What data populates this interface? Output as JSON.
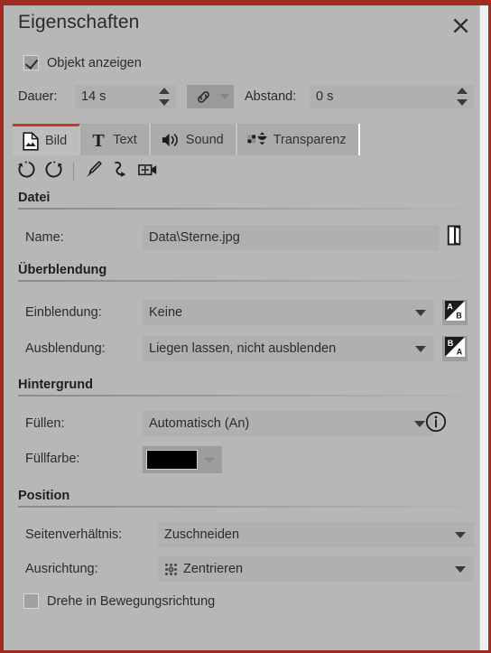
{
  "window": {
    "title": "Eigenschaften",
    "close_icon": "close-x-icon",
    "frame_color": "#9f2b23"
  },
  "show_object": {
    "label": "Objekt anzeigen",
    "checked": true
  },
  "timing": {
    "duration_label": "Dauer:",
    "duration_value": "14 s",
    "link_icon": "chain-link-icon",
    "distance_label": "Abstand:",
    "distance_value": "0 s"
  },
  "tabs": [
    {
      "label": "Bild",
      "icon": "image-file-icon",
      "active": true
    },
    {
      "label": "Text",
      "icon": "text-t-icon",
      "active": false
    },
    {
      "label": "Sound",
      "icon": "speaker-icon",
      "active": false
    },
    {
      "label": "Transparenz",
      "icon": "transparency-icon",
      "active": false
    }
  ],
  "toolstrip": [
    {
      "name": "rotate-left-icon"
    },
    {
      "name": "rotate-right-icon"
    },
    {
      "name": "separator"
    },
    {
      "name": "brush-icon"
    },
    {
      "name": "motion-path-icon"
    },
    {
      "name": "pan-camera-icon"
    }
  ],
  "sections": {
    "file": {
      "title": "Datei",
      "name_label": "Name:",
      "name_value": "Data\\Sterne.jpg",
      "browse_icon": "folder-browse-icon"
    },
    "fade": {
      "title": "Überblendung",
      "fadein_label": "Einblendung:",
      "fadein_value": "Keine",
      "fadein_button_icon": "transition-a-over-b-icon",
      "fadeout_label": "Ausblendung:",
      "fadeout_value": "Liegen lassen, nicht ausblenden",
      "fadeout_button_icon": "transition-b-over-a-icon"
    },
    "background": {
      "title": "Hintergrund",
      "fill_label": "Füllen:",
      "fill_value": "Automatisch (An)",
      "info_icon": "info-circle-icon",
      "fillcolor_label": "Füllfarbe:",
      "fillcolor_value": "#000000"
    },
    "position": {
      "title": "Position",
      "aspect_label": "Seitenverhältnis:",
      "aspect_value": "Zuschneiden",
      "align_label": "Ausrichtung:",
      "align_value": "Zentrieren",
      "align_icon": "align-center-grid-icon",
      "rotate_label": "Drehe in Bewegungsrichtung",
      "rotate_checked": false
    }
  }
}
